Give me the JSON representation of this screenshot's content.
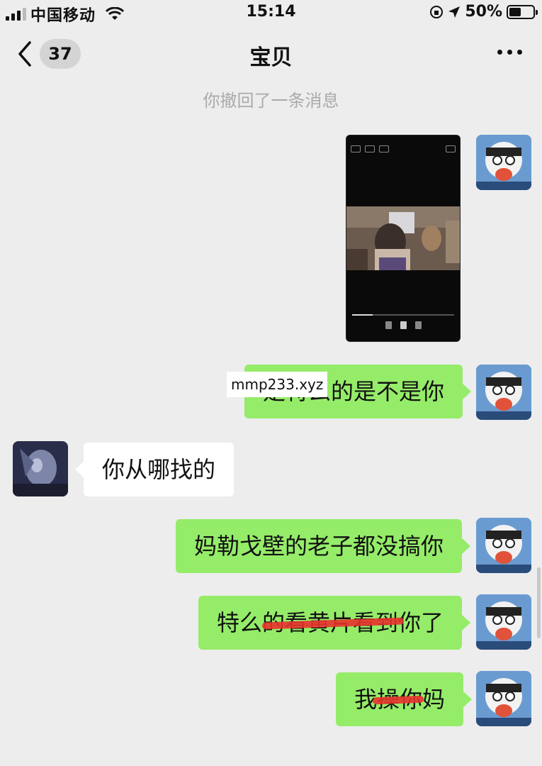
{
  "status_bar": {
    "carrier": "中国移动",
    "time": "15:14",
    "battery": "50%"
  },
  "nav": {
    "unread_count": "37",
    "title": "宝贝"
  },
  "recall_notice": "你撤回了一条消息",
  "watermark": "mmp233.xyz",
  "messages": [
    {
      "sender": "me",
      "type": "video"
    },
    {
      "sender": "me",
      "type": "text",
      "text": "是特么的是不是你"
    },
    {
      "sender": "other",
      "type": "text",
      "text": "你从哪找的"
    },
    {
      "sender": "me",
      "type": "text",
      "text": "妈勒戈壁的老子都没搞你"
    },
    {
      "sender": "me",
      "type": "text",
      "text": "特么的看黄片看到你了"
    },
    {
      "sender": "me",
      "type": "text",
      "text": "我操你妈"
    }
  ],
  "colors": {
    "background": "#ededed",
    "my_bubble": "#95ec69",
    "other_bubble": "#ffffff",
    "scribble": "#e8332d"
  },
  "icons": [
    "back-arrow-icon",
    "more-icon",
    "wifi-icon",
    "location-arrow-icon",
    "lock-rotation-icon"
  ]
}
